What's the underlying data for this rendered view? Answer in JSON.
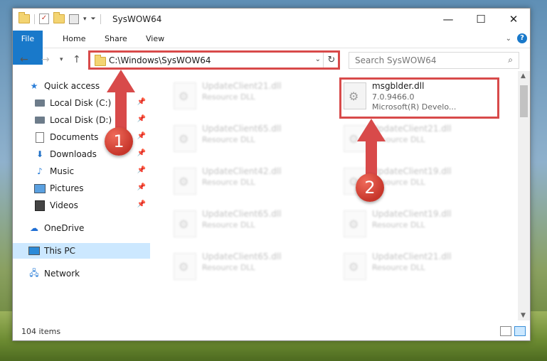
{
  "window": {
    "title": "SysWOW64"
  },
  "ribbon": {
    "tabs": [
      "File",
      "Home",
      "Share",
      "View"
    ],
    "help": "?"
  },
  "address": {
    "path": "C:\\Windows\\SysWOW64"
  },
  "search": {
    "placeholder": "Search SysWOW64"
  },
  "sidebar": {
    "items": [
      {
        "label": "Quick access",
        "icon": "star-icon"
      },
      {
        "label": "Local Disk (C:)",
        "icon": "disk-icon",
        "pinned": true
      },
      {
        "label": "Local Disk (D:)",
        "icon": "disk-icon",
        "pinned": true
      },
      {
        "label": "Documents",
        "icon": "documents-icon",
        "pinned": true
      },
      {
        "label": "Downloads",
        "icon": "download-icon",
        "pinned": true
      },
      {
        "label": "Music",
        "icon": "music-icon",
        "pinned": true
      },
      {
        "label": "Pictures",
        "icon": "pictures-icon",
        "pinned": true
      },
      {
        "label": "Videos",
        "icon": "videos-icon",
        "pinned": true
      },
      {
        "label": "OneDrive",
        "icon": "cloud-icon"
      },
      {
        "label": "This PC",
        "icon": "pc-icon",
        "selected": true
      },
      {
        "label": "Network",
        "icon": "network-icon"
      }
    ]
  },
  "files": {
    "highlighted": {
      "name": "msgblder.dll",
      "version": "7.0.9466.0",
      "company": "Microsoft(R) Develo..."
    },
    "left_column": [
      {
        "name": "UpdateClient21.dll",
        "type": "Resource DLL"
      },
      {
        "name": "UpdateClient65.dll",
        "type": "Resource DLL"
      },
      {
        "name": "UpdateClient42.dll",
        "type": "Resource DLL"
      },
      {
        "name": "UpdateClient65.dll",
        "type": "Resource DLL"
      },
      {
        "name": "UpdateClient65.dll",
        "type": "Resource DLL"
      }
    ],
    "right_column": [
      {
        "name": "UpdateClient21.dll",
        "type": "Resource DLL"
      },
      {
        "name": "UpdateClient19.dll",
        "type": "Resource DLL"
      },
      {
        "name": "UpdateClient19.dll",
        "type": "Resource DLL"
      },
      {
        "name": "UpdateClient21.dll",
        "type": "Resource DLL"
      }
    ]
  },
  "status": {
    "item_count": "104 items"
  },
  "callouts": {
    "one": "1",
    "two": "2",
    "color": "#d84a4a"
  }
}
